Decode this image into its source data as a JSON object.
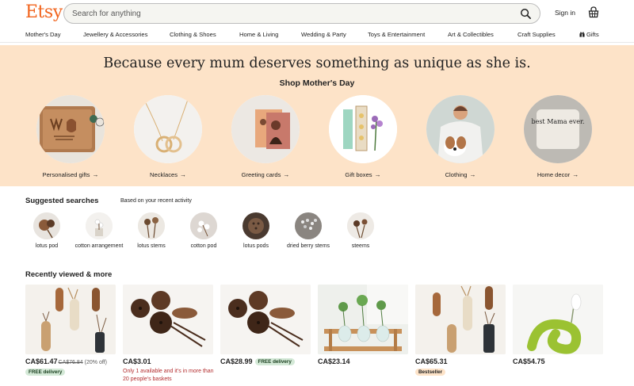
{
  "header": {
    "logo": "Etsy",
    "search_placeholder": "Search for anything",
    "sign_in": "Sign in"
  },
  "nav": {
    "items": [
      "Mother's Day",
      "Jewellery & Accessories",
      "Clothing & Shoes",
      "Home & Living",
      "Wedding & Party",
      "Toys & Entertainment",
      "Art & Collectibles",
      "Craft Supplies",
      "Gifts"
    ]
  },
  "hero": {
    "headline": "Because every mum deserves something as unique as she is.",
    "subheading": "Shop Mother's Day",
    "categories": [
      {
        "label": "Personalised gifts"
      },
      {
        "label": "Necklaces"
      },
      {
        "label": "Greeting cards"
      },
      {
        "label": "Gift boxes"
      },
      {
        "label": "Clothing"
      },
      {
        "label": "Home decor"
      }
    ],
    "pillow_text": "best Mama ever.",
    "arrow": "→"
  },
  "suggested": {
    "title": "Suggested searches",
    "note": "Based on your recent activity",
    "items": [
      {
        "label": "lotus pod"
      },
      {
        "label": "cotton arrangement"
      },
      {
        "label": "lotus stems"
      },
      {
        "label": "cotton pod"
      },
      {
        "label": "lotus pods"
      },
      {
        "label": "dried berry stems"
      },
      {
        "label": "steems"
      }
    ]
  },
  "recent": {
    "title": "Recently viewed & more",
    "items": [
      {
        "price": "CA$61.47",
        "old_price": "CA$76.84",
        "discount": "(20% off)",
        "badge": "FREE delivery"
      },
      {
        "price": "CA$3.01",
        "note": "Only 1 available and it's in more than 20 people's baskets"
      },
      {
        "price": "CA$28.99",
        "badge": "FREE delivery"
      },
      {
        "price": "CA$23.14"
      },
      {
        "price": "CA$65.31",
        "bestseller": "Bestseller"
      },
      {
        "price": "CA$54.75"
      }
    ]
  },
  "colors": {
    "brand": "#F1641E",
    "hero_bg": "#FDE3C8",
    "free_delivery_bg": "#D4E9D7",
    "stock_warning": "#B32D2E"
  },
  "icons": [
    "search-icon",
    "basket-icon",
    "gift-icon",
    "arrow-right-icon"
  ]
}
